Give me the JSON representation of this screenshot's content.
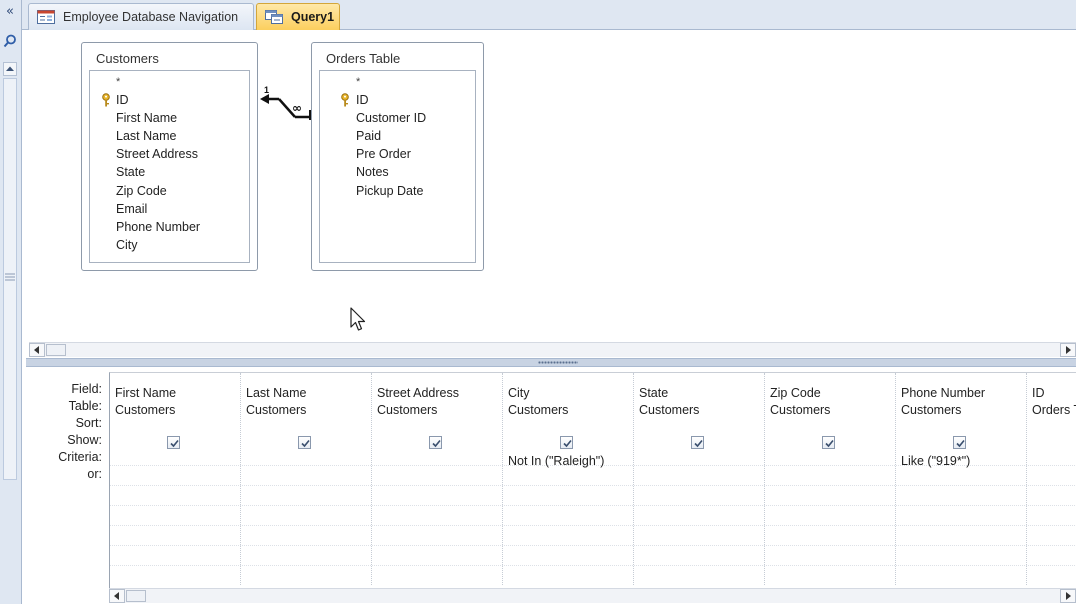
{
  "tabs": [
    {
      "label": "Employee Database Navigation",
      "active": false,
      "icon": "form-icon"
    },
    {
      "label": "Query1",
      "active": true,
      "icon": "query-icon"
    }
  ],
  "nav_pane": {
    "collapse_glyph": "«"
  },
  "tables": [
    {
      "name": "Customers",
      "star": "*",
      "fields": [
        "ID",
        "First Name",
        "Last Name",
        "Street Address",
        "State",
        "Zip Code",
        "Email",
        "Phone Number",
        "City"
      ],
      "primary_key": "ID"
    },
    {
      "name": "Orders Table",
      "star": "*",
      "fields": [
        "ID",
        "Customer ID",
        "Paid",
        "Pre Order",
        "Notes",
        "Pickup Date"
      ],
      "primary_key": "ID"
    }
  ],
  "relationship": {
    "one_side": "1",
    "many_side": "∞"
  },
  "grid": {
    "row_labels": [
      "Field:",
      "Table:",
      "Sort:",
      "Show:",
      "Criteria:",
      "or:"
    ],
    "columns": [
      {
        "field": "First Name",
        "table": "Customers",
        "show": true,
        "criteria": ""
      },
      {
        "field": "Last Name",
        "table": "Customers",
        "show": true,
        "criteria": ""
      },
      {
        "field": "Street Address",
        "table": "Customers",
        "show": true,
        "criteria": ""
      },
      {
        "field": "City",
        "table": "Customers",
        "show": true,
        "criteria": "Not In (\"Raleigh\")"
      },
      {
        "field": "State",
        "table": "Customers",
        "show": true,
        "criteria": ""
      },
      {
        "field": "Zip Code",
        "table": "Customers",
        "show": true,
        "criteria": ""
      },
      {
        "field": "Phone Number",
        "table": "Customers",
        "show": true,
        "criteria": "Like (\"919*\")"
      },
      {
        "field": "ID",
        "table": "Orders T",
        "show": false,
        "criteria": ""
      }
    ]
  },
  "colors": {
    "active_tab": "#fbcf5e",
    "chrome": "#dfe7f2",
    "border": "#a9b9d0"
  }
}
